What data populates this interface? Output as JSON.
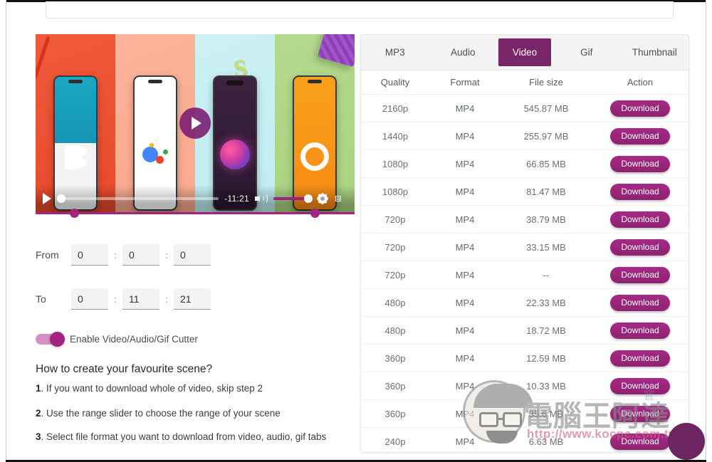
{
  "top": {
    "url_placeholder": ""
  },
  "player": {
    "play_overlay_icon": "play-icon",
    "controls": {
      "play_icon": "play-icon",
      "time_remaining": "-11:21",
      "volume_icon": "volume-high-icon",
      "settings_icon": "gear-icon",
      "fullscreen_icon": "fullscreen-icon"
    },
    "range_slider": {
      "start_percent": 12,
      "end_percent": 87
    }
  },
  "cutter": {
    "from_label": "From",
    "to_label": "To",
    "separator": ":",
    "from": {
      "hours": "0",
      "minutes": "0",
      "seconds": "0"
    },
    "to": {
      "hours": "0",
      "minutes": "11",
      "seconds": "21"
    },
    "toggle_label": "Enable Video/Audio/Gif Cutter",
    "toggle_on": true
  },
  "howto": {
    "title": "How to create your favourite scene?",
    "steps": [
      {
        "num": "1",
        "dot": ".",
        "text": "If you want to download whole of video, skip step 2"
      },
      {
        "num": "2",
        "dot": ".",
        "text": "Use the range slider to choose the range of your scene"
      },
      {
        "num": "3",
        "dot": ".",
        "text": "Select file format you want to download from video, audio, gif tabs"
      }
    ]
  },
  "downloads": {
    "tabs": [
      {
        "label": "MP3",
        "active": false
      },
      {
        "label": "Audio",
        "active": false
      },
      {
        "label": "Video",
        "active": true
      },
      {
        "label": "Gif",
        "active": false
      },
      {
        "label": "Thumbnail",
        "active": false
      }
    ],
    "columns": [
      "Quality",
      "Format",
      "File size",
      "Action"
    ],
    "action_label": "Download",
    "rows": [
      {
        "quality": "2160p",
        "format": "MP4",
        "size": "545.87 MB"
      },
      {
        "quality": "1440p",
        "format": "MP4",
        "size": "255.97 MB"
      },
      {
        "quality": "1080p",
        "format": "MP4",
        "size": "66.85 MB"
      },
      {
        "quality": "1080p",
        "format": "MP4",
        "size": "81.47 MB"
      },
      {
        "quality": "720p",
        "format": "MP4",
        "size": "38.79 MB"
      },
      {
        "quality": "720p",
        "format": "MP4",
        "size": "33.15 MB"
      },
      {
        "quality": "720p",
        "format": "MP4",
        "size": "--"
      },
      {
        "quality": "480p",
        "format": "MP4",
        "size": "22.33 MB"
      },
      {
        "quality": "480p",
        "format": "MP4",
        "size": "18.72 MB"
      },
      {
        "quality": "360p",
        "format": "MP4",
        "size": "12.59 MB"
      },
      {
        "quality": "360p",
        "format": "MP4",
        "size": "10.33 MB"
      },
      {
        "quality": "360p",
        "format": "MP4",
        "size": "35.6 MB"
      },
      {
        "quality": "240p",
        "format": "MP4",
        "size": "6.63 MB"
      }
    ]
  },
  "watermark": {
    "text": "電腦王阿達",
    "url": "http://www.kocpc.com.tw",
    "crown_icon": "crown-icon"
  },
  "colors": {
    "accent": "#a4237f",
    "tab_active_bg": "#7b2569",
    "download_btn": "#9c2b7e",
    "fab": "#6c2560"
  }
}
